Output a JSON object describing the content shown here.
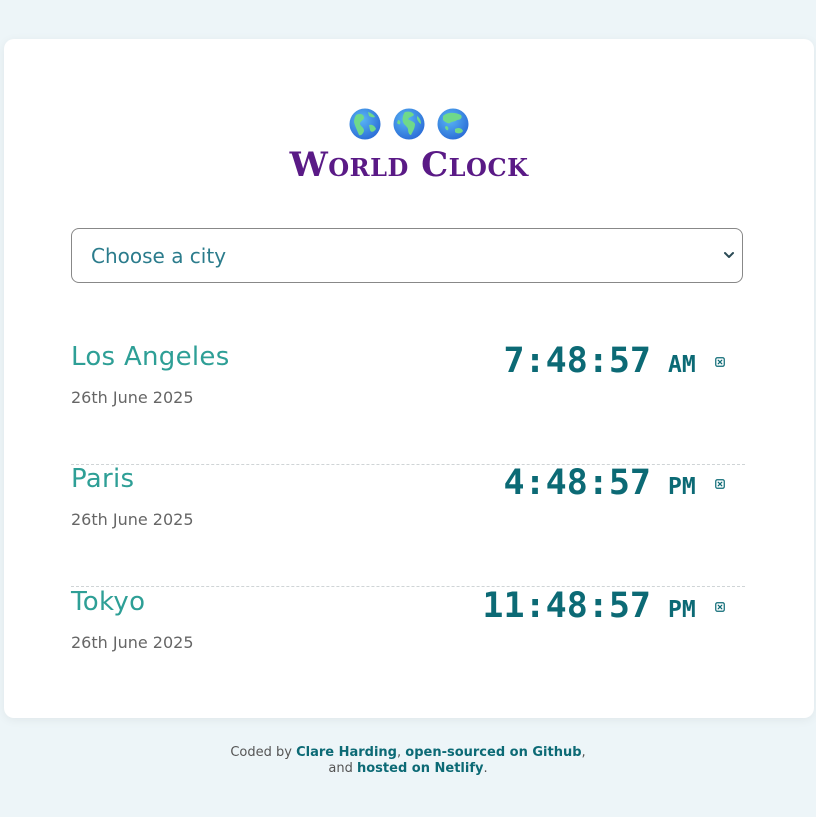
{
  "header": {
    "globes": [
      "globe-americas-icon",
      "globe-europe-africa-icon",
      "globe-asia-australia-icon"
    ],
    "title": "World Clock"
  },
  "selector": {
    "selected": "Choose a city"
  },
  "cities": [
    {
      "name": "Los Angeles",
      "date": "26th June 2025",
      "time": "7:48:57",
      "ampm": "AM",
      "remove_icon": "close-icon"
    },
    {
      "name": "Paris",
      "date": "26th June 2025",
      "time": "4:48:57",
      "ampm": "PM",
      "remove_icon": "close-icon"
    },
    {
      "name": "Tokyo",
      "date": "26th June 2025",
      "time": "11:48:57",
      "ampm": "PM",
      "remove_icon": "close-icon"
    }
  ],
  "footer": {
    "prefix": "Coded by ",
    "author": "Clare Harding",
    "sep1": ", ",
    "github": "open-sourced on Github",
    "sep2": ",",
    "and": "and ",
    "netlify": "hosted on Netlify",
    "end": "."
  },
  "colors": {
    "background": "#edf5f8",
    "title": "#5a1a86",
    "city": "#2e9f96",
    "time": "#0c6a75",
    "select_text": "#2b7c8c"
  }
}
